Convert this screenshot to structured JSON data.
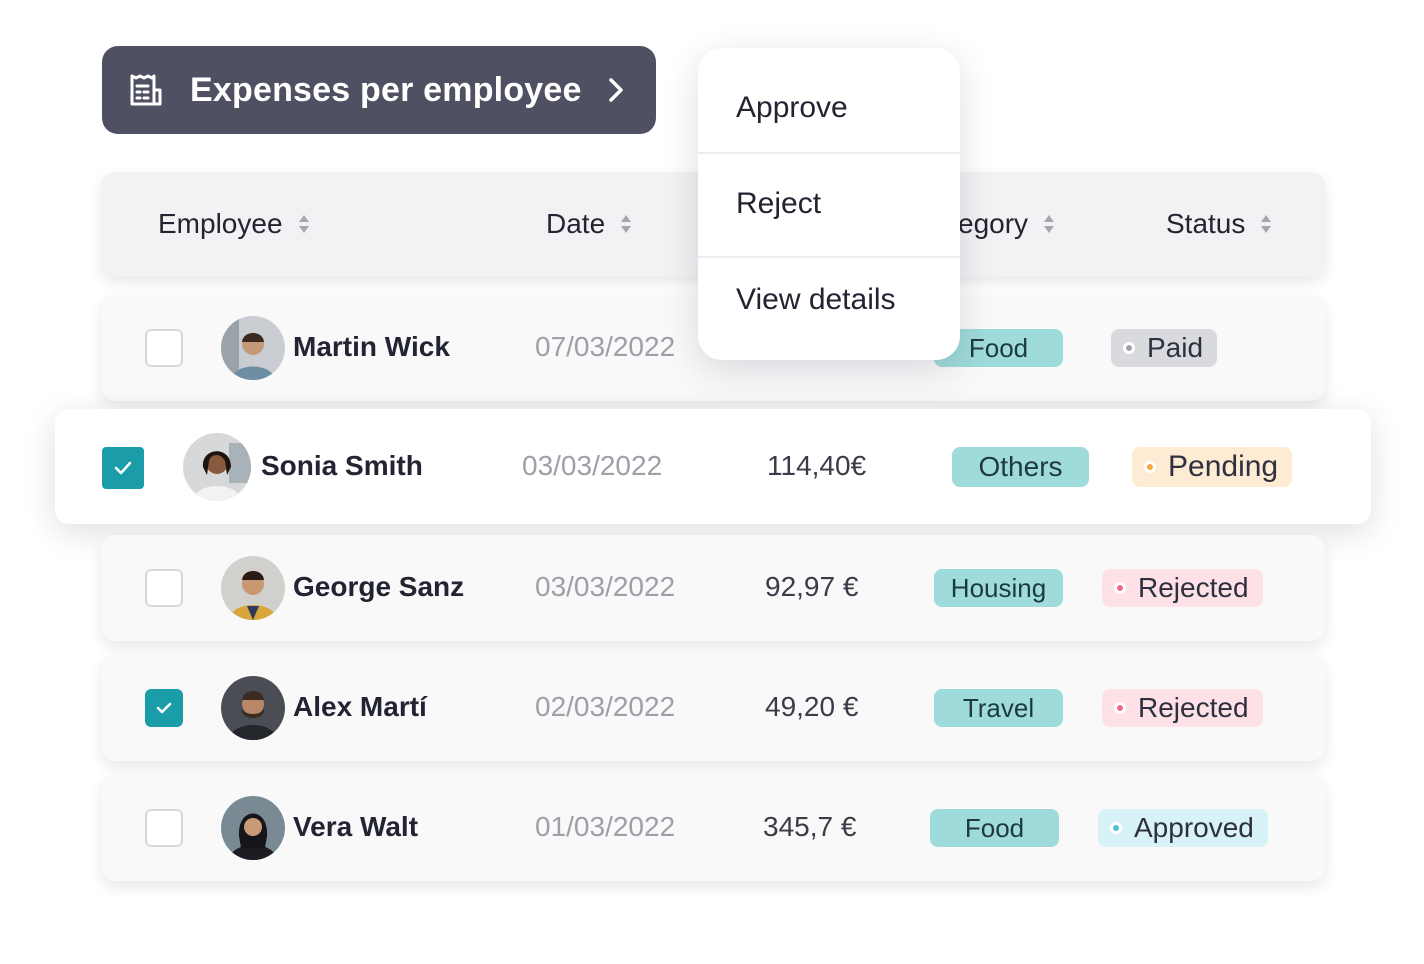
{
  "title": {
    "label": "Expenses per employee"
  },
  "columns": {
    "employee": "Employee",
    "date": "Date",
    "category": "egory",
    "status": "Status"
  },
  "menu": {
    "items": [
      "Approve",
      "Reject",
      "View details"
    ]
  },
  "rows": [
    {
      "name": "Martin Wick",
      "date": "07/03/2022",
      "amount": ",",
      "category": "Food",
      "status": "Paid",
      "checked": false,
      "status_color": "#d9dade",
      "status_dot": "#a0a2aa"
    },
    {
      "name": "Sonia Smith",
      "date": "03/03/2022",
      "amount": "114,40€",
      "category": "Others",
      "status": "Pending",
      "checked": true,
      "status_color": "#fdecd3",
      "status_dot": "#f5a742"
    },
    {
      "name": "George Sanz",
      "date": "03/03/2022",
      "amount": "92,97 €",
      "category": "Housing",
      "status": "Rejected",
      "checked": false,
      "status_color": "#fde1e7",
      "status_dot": "#ee6a8b"
    },
    {
      "name": "Alex Martí",
      "date": "02/03/2022",
      "amount": "49,20 €",
      "category": "Travel",
      "status": "Rejected",
      "checked": true,
      "status_color": "#fde1e7",
      "status_dot": "#ee6a8b"
    },
    {
      "name": "Vera Walt",
      "date": "01/03/2022",
      "amount": "345,7 €",
      "category": "Food",
      "status": "Approved",
      "checked": false,
      "status_color": "#d8f3f7",
      "status_dot": "#4bc3d6"
    }
  ],
  "colors": {
    "accent": "#1a9da8",
    "title_bg": "#505063",
    "category_bg": "#9fdbdb"
  }
}
